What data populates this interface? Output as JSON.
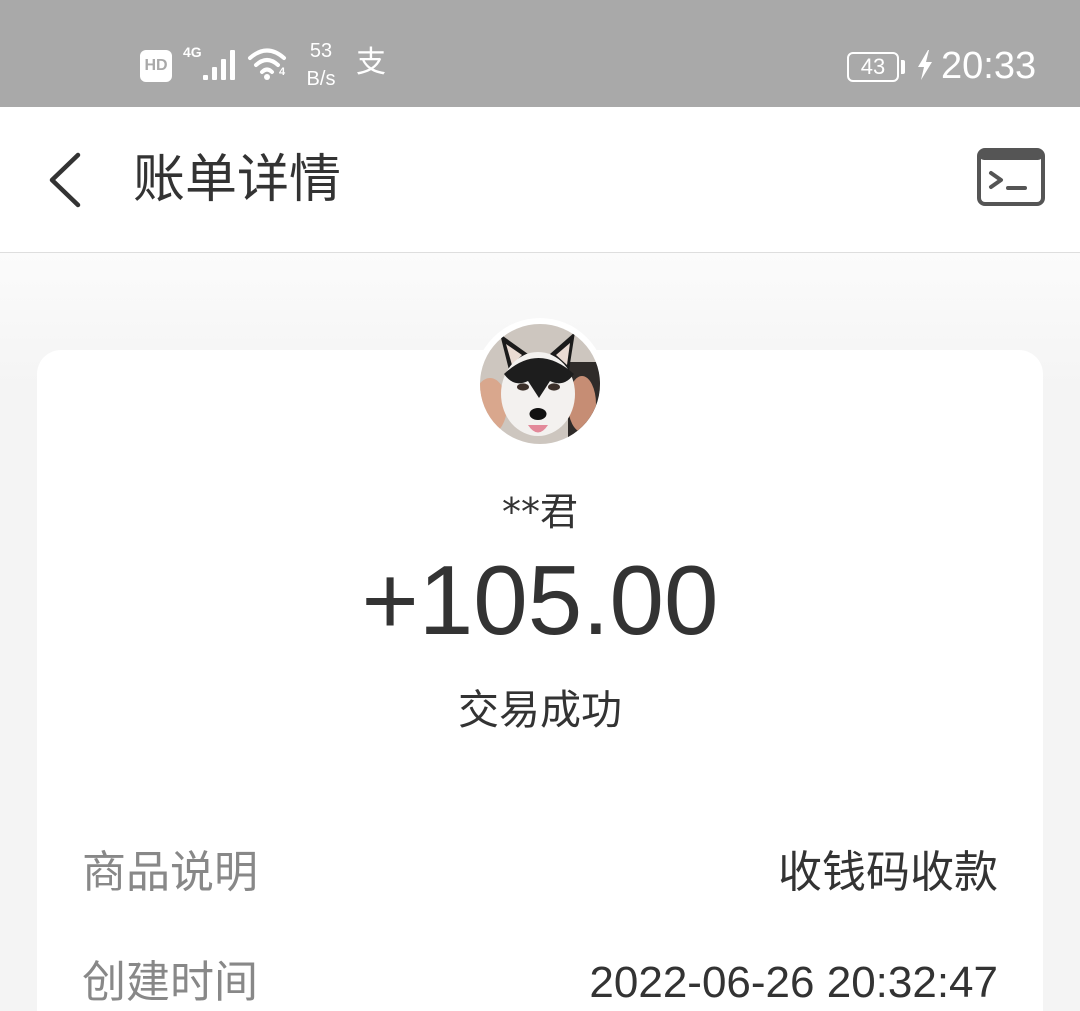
{
  "status_bar": {
    "hd": "HD",
    "network": "4G",
    "wifi_badge": "4",
    "speed_value": "53",
    "speed_unit": "B/s",
    "app_icon_text": "支",
    "battery": "43",
    "time": "20:33",
    "icons": [
      "signal-icon",
      "wifi-icon",
      "battery-icon",
      "charging-bolt-icon"
    ]
  },
  "header": {
    "title": "账单详情",
    "back_icon": "chevron-left-icon",
    "right_icon": "terminal-icon"
  },
  "bill": {
    "avatar": "husky-avatar",
    "payer_name": "**君",
    "amount": "+105.00",
    "status": "交易成功",
    "details": [
      {
        "label": "商品说明",
        "value": "收钱码收款"
      },
      {
        "label": "创建时间",
        "value": "2022-06-26 20:32:47"
      }
    ]
  },
  "theme": {
    "status_bar_bg": "#a9a9a9",
    "page_bg": "#f4f4f4",
    "card_bg": "#ffffff",
    "text_primary": "#333333",
    "text_secondary": "#888888"
  }
}
